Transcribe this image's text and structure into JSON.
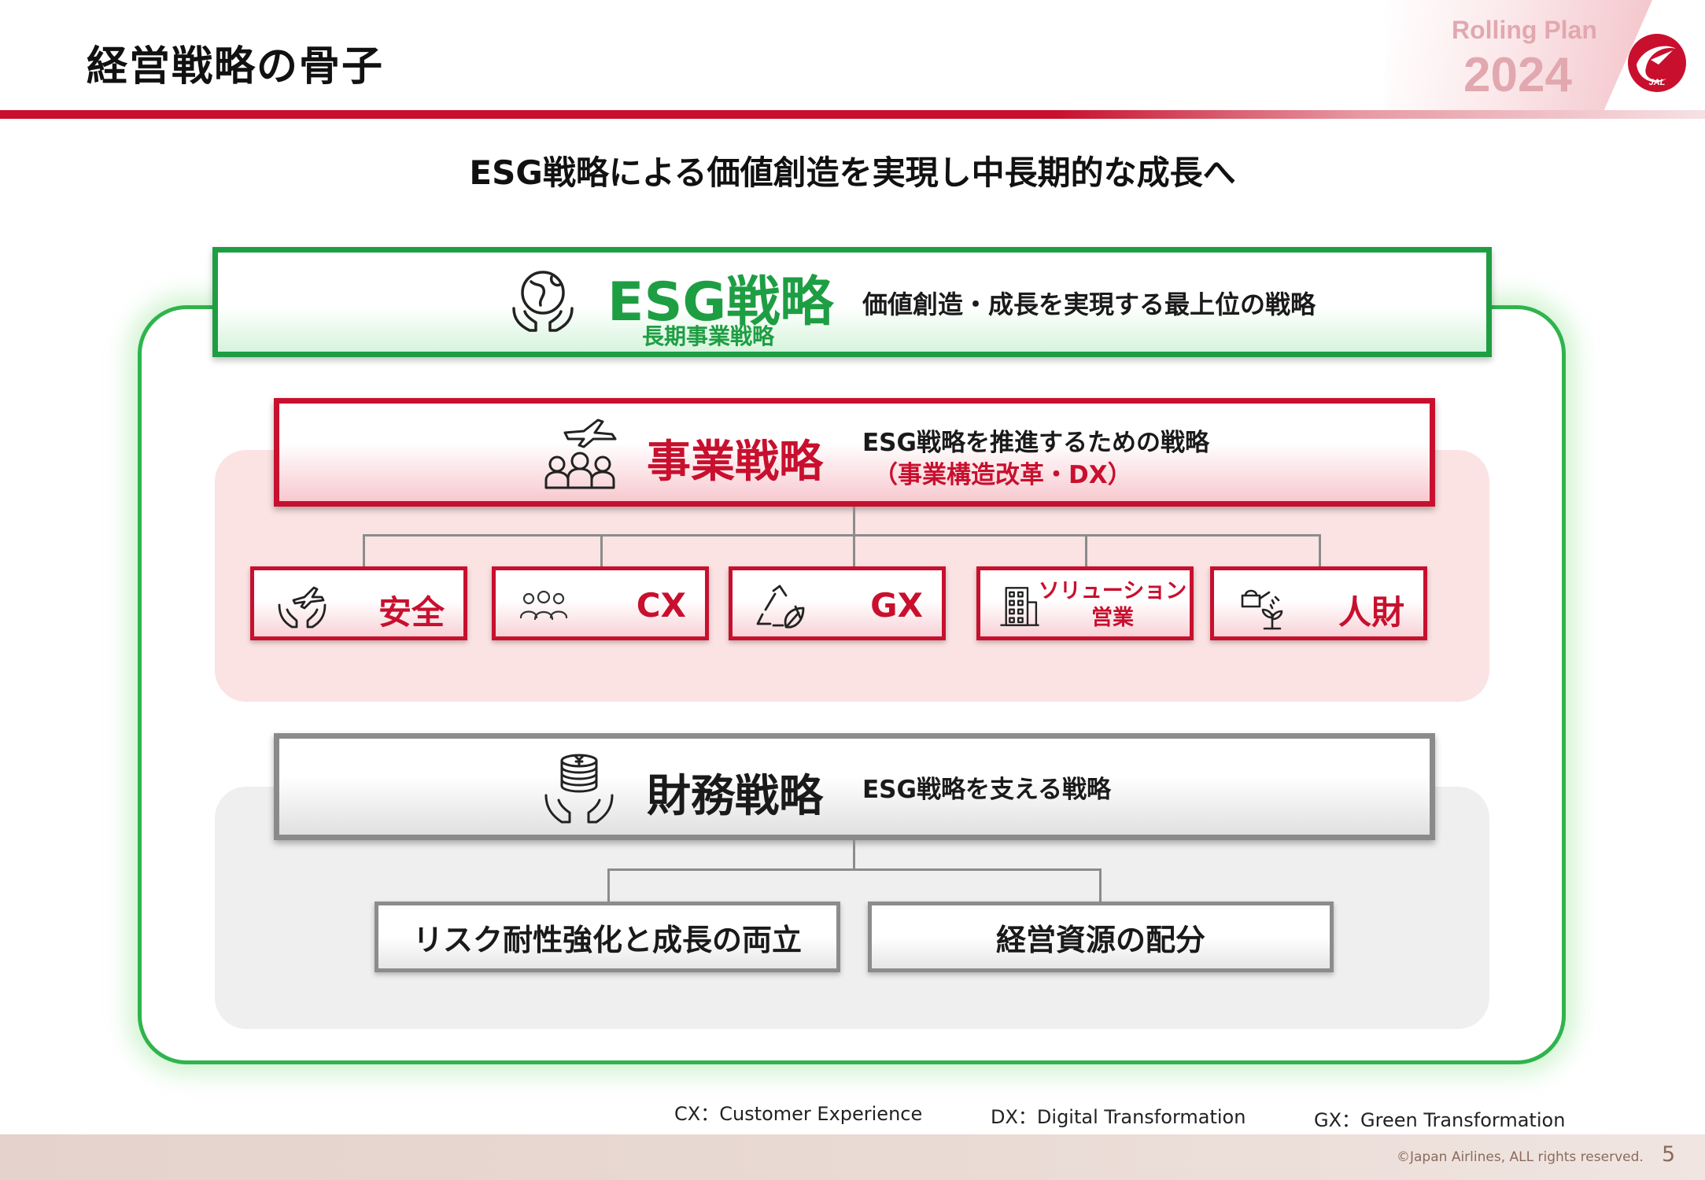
{
  "header": {
    "title": "経営戦略の骨子",
    "rolling_plan_label": "Rolling Plan",
    "rolling_plan_year": "2024",
    "logo_text": "JAL"
  },
  "subtitle": "ESG戦略による価値創造を実現し中長期的な成長へ",
  "esg": {
    "title": "ESG戦略",
    "subtitle": "長期事業戦略",
    "description": "価値創造・成長を実現する最上位の戦略",
    "icon": "globe-hands-icon"
  },
  "business": {
    "title": "事業戦略",
    "description": "ESG戦略を推進するための戦略",
    "description_sub": "（事業構造改革・DX）",
    "icon": "airplane-staff-icon",
    "items": [
      {
        "label": "安全",
        "icon": "airplane-hands-icon"
      },
      {
        "label": "CX",
        "icon": "people-group-icon"
      },
      {
        "label": "GX",
        "icon": "recycle-leaf-icon"
      },
      {
        "label_line1": "ソリューション",
        "label_line2": "営業",
        "icon": "building-icon"
      },
      {
        "label": "人財",
        "icon": "watering-sprout-icon"
      }
    ]
  },
  "finance": {
    "title": "財務戦略",
    "description": "ESG戦略を支える戦略",
    "icon": "yen-coins-hands-icon",
    "items": [
      {
        "label": "リスク耐性強化と成長の両立"
      },
      {
        "label": "経営資源の配分"
      }
    ]
  },
  "abbreviations": [
    "CX：Customer Experience",
    "DX：Digital Transformation",
    "GX：Green Transformation"
  ],
  "footer": {
    "copyright": "©Japan Airlines, ALL rights reserved.",
    "page_number": "5"
  },
  "colors": {
    "jal_red": "#c8102e",
    "esg_green": "#1e9e43",
    "finance_gray": "#8a8a8a"
  }
}
